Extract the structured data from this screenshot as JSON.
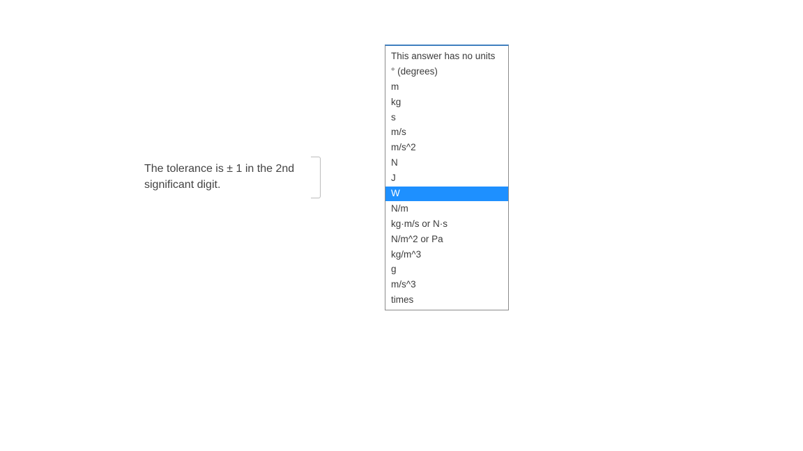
{
  "tolerance_text": "The tolerance is ± 1 in the 2nd significant digit.",
  "units": {
    "options": [
      "This answer has no units",
      "° (degrees)",
      "m",
      "kg",
      "s",
      "m/s",
      "m/s^2",
      "N",
      "J",
      "W",
      "N/m",
      "kg·m/s or N·s",
      "N/m^2 or Pa",
      "kg/m^3",
      "g",
      "m/s^3",
      "times"
    ],
    "selected_index": 9
  }
}
